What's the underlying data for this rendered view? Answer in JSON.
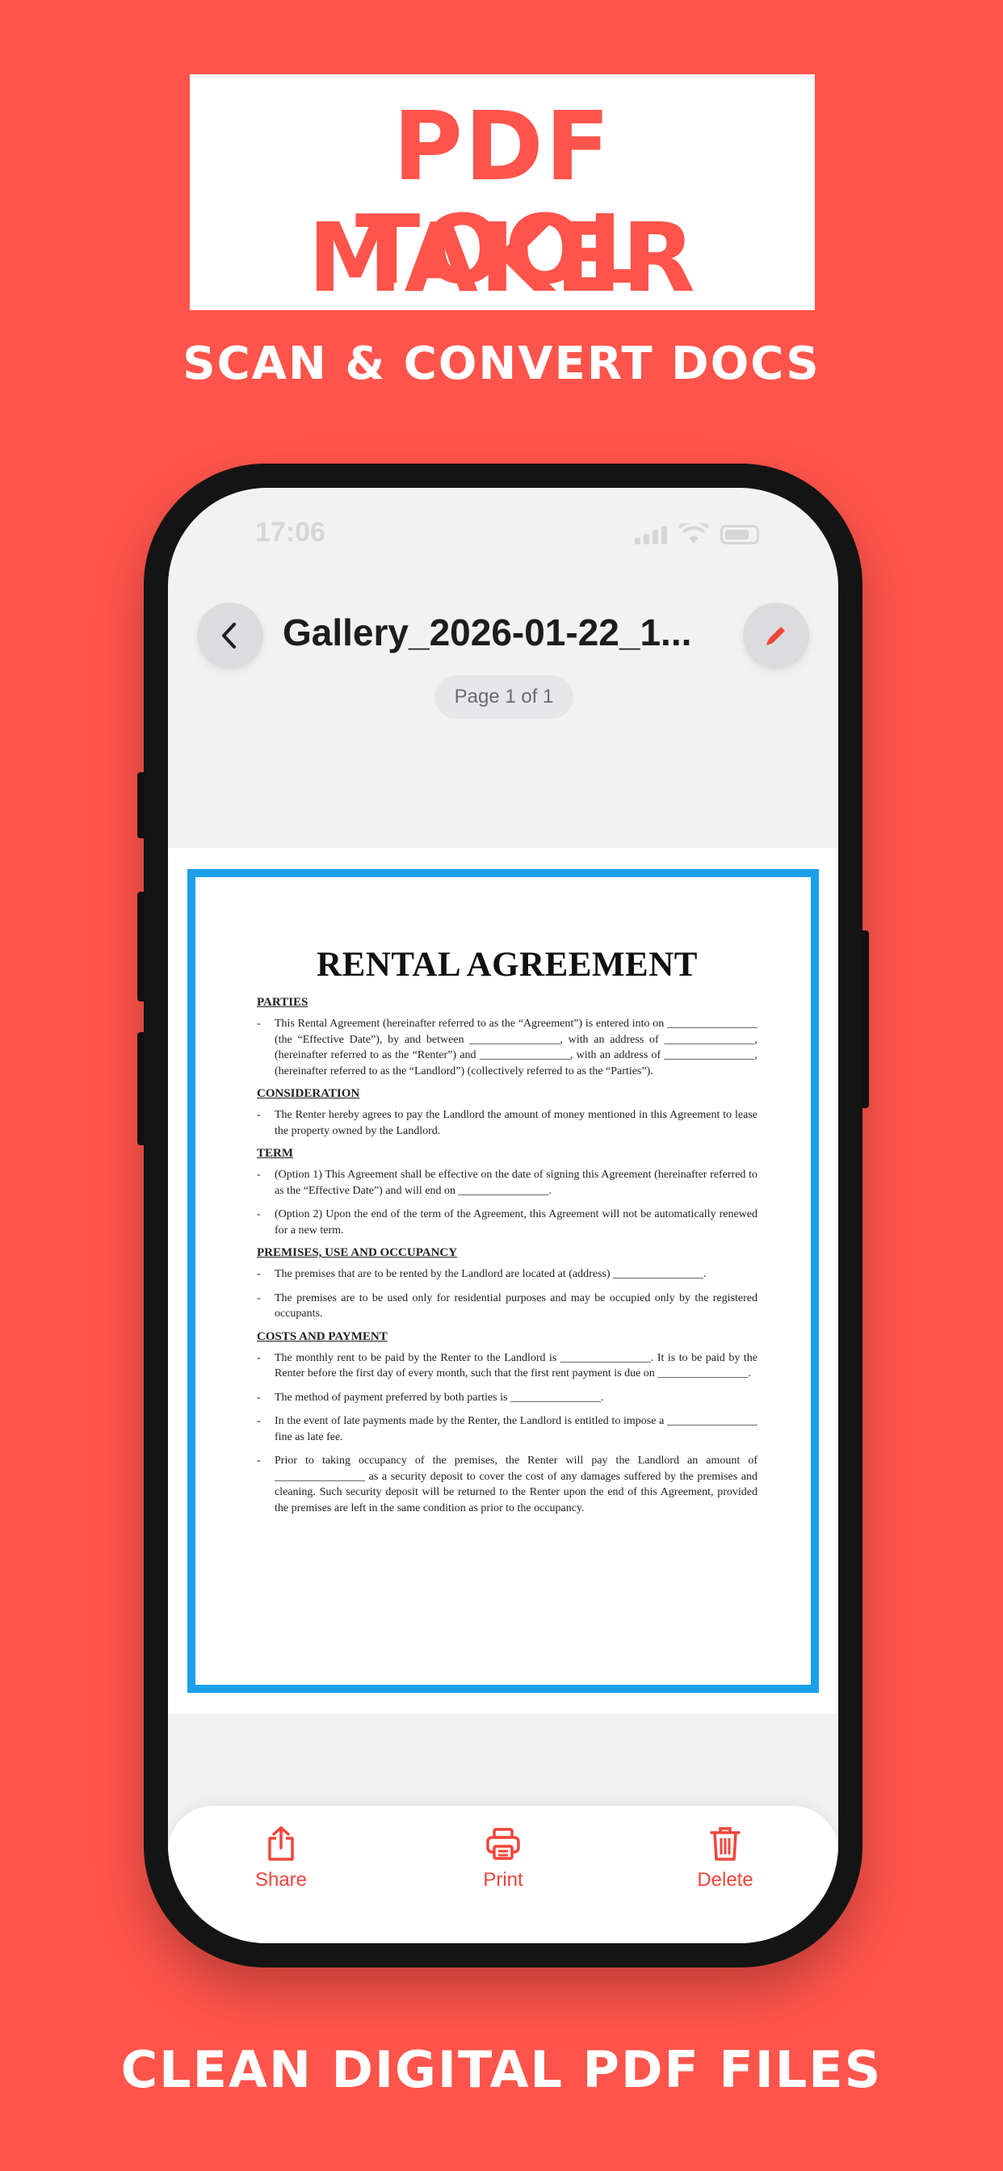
{
  "colors": {
    "background": "#ff544b",
    "accent": "#f0453a",
    "doc_border": "#1ba0ec",
    "text_dark": "#1d1d1f"
  },
  "hero": {
    "title_line1": "PDF MAKER",
    "title_line2": "TOOL",
    "subtitle": "SCAN & CONVERT DOCS"
  },
  "footer": {
    "tagline": "CLEAN DIGITAL PDF FILES"
  },
  "status_bar": {
    "time": "17:06"
  },
  "nav": {
    "title": "Gallery_2026-01-22_1...",
    "back_icon": "chevron-left-icon",
    "edit_icon": "pencil-icon"
  },
  "pager": {
    "label": "Page 1 of 1"
  },
  "document": {
    "title": "RENTAL AGREEMENT",
    "sections": [
      {
        "heading": "PARTIES",
        "items": [
          "This Rental Agreement (hereinafter referred to as the “Agreement”) is entered into on ________________ (the “Effective Date”), by and between ________________, with an address of ________________, (hereinafter referred to as the “Renter”) and ________________, with an address of ________________, (hereinafter referred to as the “Landlord”) (collectively referred to as the “Parties”)."
        ]
      },
      {
        "heading": "CONSIDERATION",
        "items": [
          "The Renter hereby agrees to pay the Landlord the amount of money mentioned in this Agreement to lease the property owned by the Landlord."
        ]
      },
      {
        "heading": "TERM",
        "items": [
          "(Option 1) This Agreement shall be effective on the date of signing this Agreement (hereinafter referred to as the “Effective Date”) and will end on ________________.",
          "(Option 2) Upon the end of the term of the Agreement, this Agreement will not be automatically renewed for a new term."
        ]
      },
      {
        "heading": "PREMISES, USE AND OCCUPANCY",
        "items": [
          "The premises that are to be rented by the Landlord are located at (address) ________________.",
          "The premises are to be used only for residential purposes and may be occupied only by the registered occupants."
        ]
      },
      {
        "heading": "COSTS AND PAYMENT",
        "items": [
          "The monthly rent to be paid by the Renter to the Landlord is ________________. It is to be paid by the Renter before the first day of every month, such that the first rent payment is due on ________________.",
          "The method of payment preferred by both parties is ________________.",
          "In the event of late payments made by the Renter, the Landlord is entitled to impose a ________________ fine as late fee.",
          "Prior to taking occupancy of the premises, the Renter will pay the Landlord an amount of ________________ as a security deposit to cover the cost of any damages suffered by the premises and cleaning. Such security deposit will be returned to the Renter upon the end of this Agreement, provided the premises are left in the same condition as prior to the occupancy."
        ]
      }
    ]
  },
  "toolbar": {
    "share_label": "Share",
    "print_label": "Print",
    "delete_label": "Delete",
    "share_icon": "share-icon",
    "print_icon": "printer-icon",
    "delete_icon": "trash-icon"
  }
}
